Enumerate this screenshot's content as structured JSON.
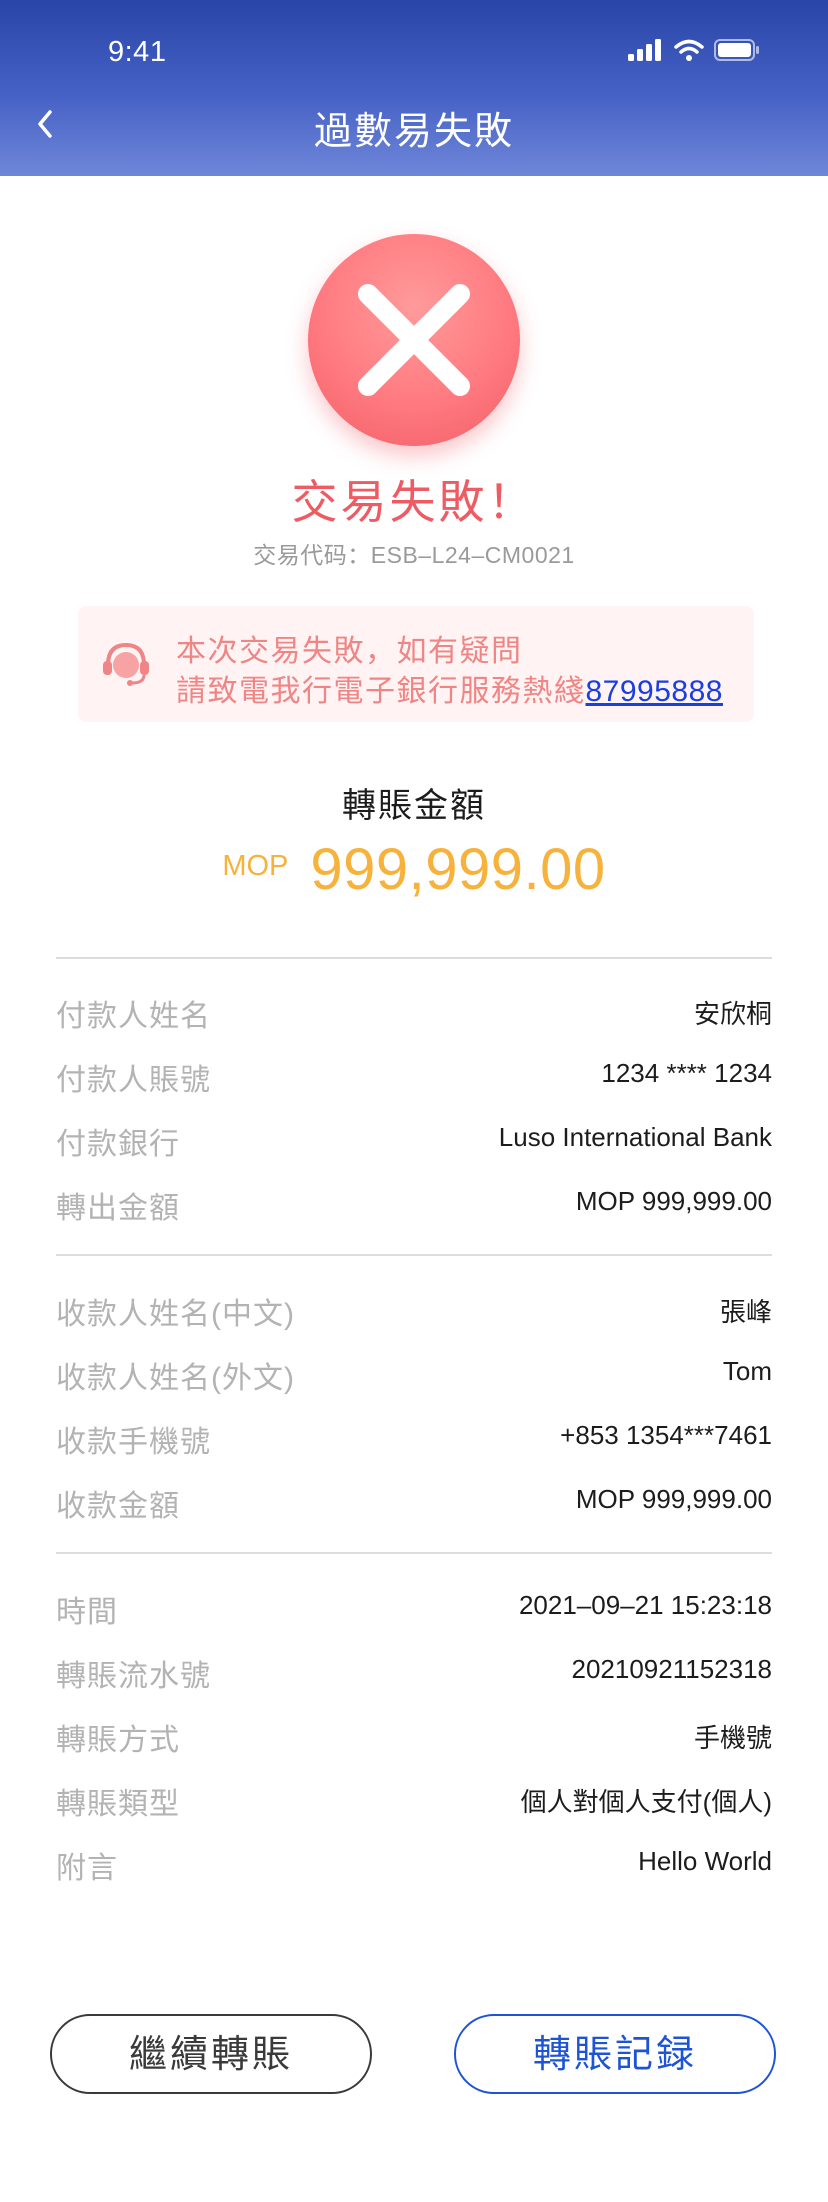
{
  "status_bar": {
    "time": "9:41"
  },
  "nav": {
    "title": "過數易失敗"
  },
  "result": {
    "title": "交易失敗！",
    "code_label": "交易代码：",
    "code": "ESB–L24–CM0021"
  },
  "notice": {
    "line1": "本次交易失敗，如有疑問",
    "line2_prefix": "請致電我行電子銀行服務熱綫",
    "phone": "87995888"
  },
  "amount": {
    "label": "轉賬金額",
    "currency": "MOP",
    "value": "999,999.00"
  },
  "details": {
    "payer_name_label": "付款人姓名",
    "payer_name": "安欣桐",
    "payer_account_label": "付款人賬號",
    "payer_account": "1234 **** 1234",
    "payer_bank_label": "付款銀行",
    "payer_bank": "Luso International Bank",
    "out_amount_label": "轉出金額",
    "out_amount": "MOP  999,999.00",
    "payee_name_cn_label": "收款人姓名(中文)",
    "payee_name_cn": "張峰",
    "payee_name_en_label": "收款人姓名(外文)",
    "payee_name_en": "Tom",
    "payee_mobile_label": "收款手機號",
    "payee_mobile": "+853 1354***7461",
    "in_amount_label": "收款金額",
    "in_amount": "MOP  999,999.00",
    "time_label": "時間",
    "time": "2021–09–21 15:23:18",
    "serial_label": "轉賬流水號",
    "serial": "20210921152318",
    "method_label": "轉賬方式",
    "method": "手機號",
    "type_label": "轉賬類型",
    "type": "個人對個人支付(個人)",
    "memo_label": "附言",
    "memo": "Hello World"
  },
  "buttons": {
    "continue": "繼續轉賬",
    "records": "轉賬記録"
  },
  "colors": {
    "header_top": "#2a45a8",
    "header_bottom": "#6f86d8",
    "fail_red": "#ef5b62",
    "notice_text": "#f08585",
    "notice_bg": "#fff3f3",
    "amount_orange": "#f6b23a",
    "link_blue": "#1a3fe0",
    "primary_blue": "#1d54d6"
  },
  "icons": {
    "back": "chevron-left-icon",
    "fail": "close-x-icon",
    "support": "customer-service-headset-icon",
    "signal": "cellular-signal-icon",
    "wifi": "wifi-icon",
    "battery": "battery-icon"
  }
}
